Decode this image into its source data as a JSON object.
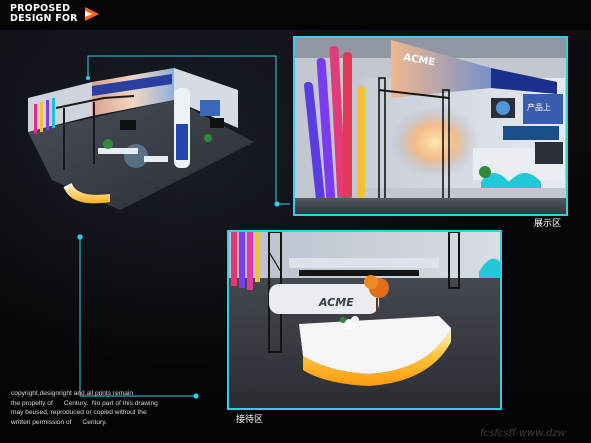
{
  "header": {
    "title_line1": "PROPOSED",
    "title_line2": "DESIGN FOR",
    "logo_icon": "arrow-logo-icon"
  },
  "panels": {
    "top": {
      "caption": "展示区",
      "sign_text": "ACME",
      "screen_text": "产品上"
    },
    "bottom": {
      "caption": "接待区",
      "sign_text": "ACME"
    }
  },
  "copyright": {
    "line1": "copyright,designright and all prints remain",
    "line2": "the propelty of      Century.  No part of this drawing",
    "line3": "may beused, reproduced or copied without the",
    "line4": "written permission of      Century."
  },
  "watermark": "fcsfcsff www.dzw",
  "colors": {
    "accent": "#2fd0e8",
    "logo_orange": "#ff6a1a",
    "background": "#050608"
  }
}
